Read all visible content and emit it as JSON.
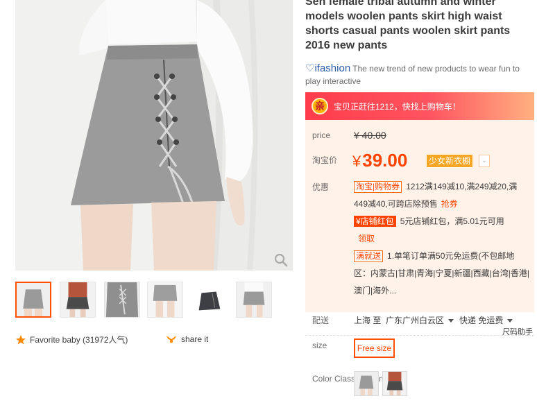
{
  "product": {
    "title": "Sen female tribal autumn and winter models woolen pants skirt high waist shorts casual pants woolen skirt pants 2016 new pants",
    "brand_logo": "ifashion",
    "brand_tagline": "The new trend of new products to wear fun to play interactive"
  },
  "promo_banner": {
    "badge": "亲",
    "text": "宝贝正赶往1212，快找上购物车！"
  },
  "pricing": {
    "price_label": "price",
    "original_price": "¥ 40.00",
    "taobao_label": "淘宝价",
    "currency": "¥",
    "current_price": "39.00",
    "price_tag": "少女新衣橱",
    "discount_label": "优惠",
    "coupon_tag": "淘宝|购物券",
    "coupon_text_1": "1212满149减10,满249减20,满449减40,可跨店除预售",
    "coupon_link": "抢券",
    "store_tag": "¥店铺红包",
    "store_text": "5元店铺红包，满5.01元可用",
    "store_link": "领取",
    "shipping_tag": "满就送",
    "shipping_promo": "1.单笔订单满50元免运费(不包邮地区：内蒙古|甘肃|青海|宁夏|新疆|西藏|台湾|香港|澳门|海外..."
  },
  "delivery": {
    "label": "配送",
    "from": "上海 至",
    "to": "广东广州白云区",
    "method": "快递 免运费",
    "size_helper": "尺码助手"
  },
  "sku": {
    "size_label": "size",
    "size_value": "Free size",
    "color_label": "Color Classification"
  },
  "social": {
    "favorite": "Favorite baby (31972人气)",
    "share": "share it"
  },
  "icons": [
    "zoom-icon",
    "star-icon",
    "share-icon",
    "chevron-down-icon"
  ],
  "colors": {
    "accent": "#ff4400",
    "banner": "#ff3c4b",
    "price_bg": "#fff2e8",
    "brand": "#2b5ca8"
  }
}
